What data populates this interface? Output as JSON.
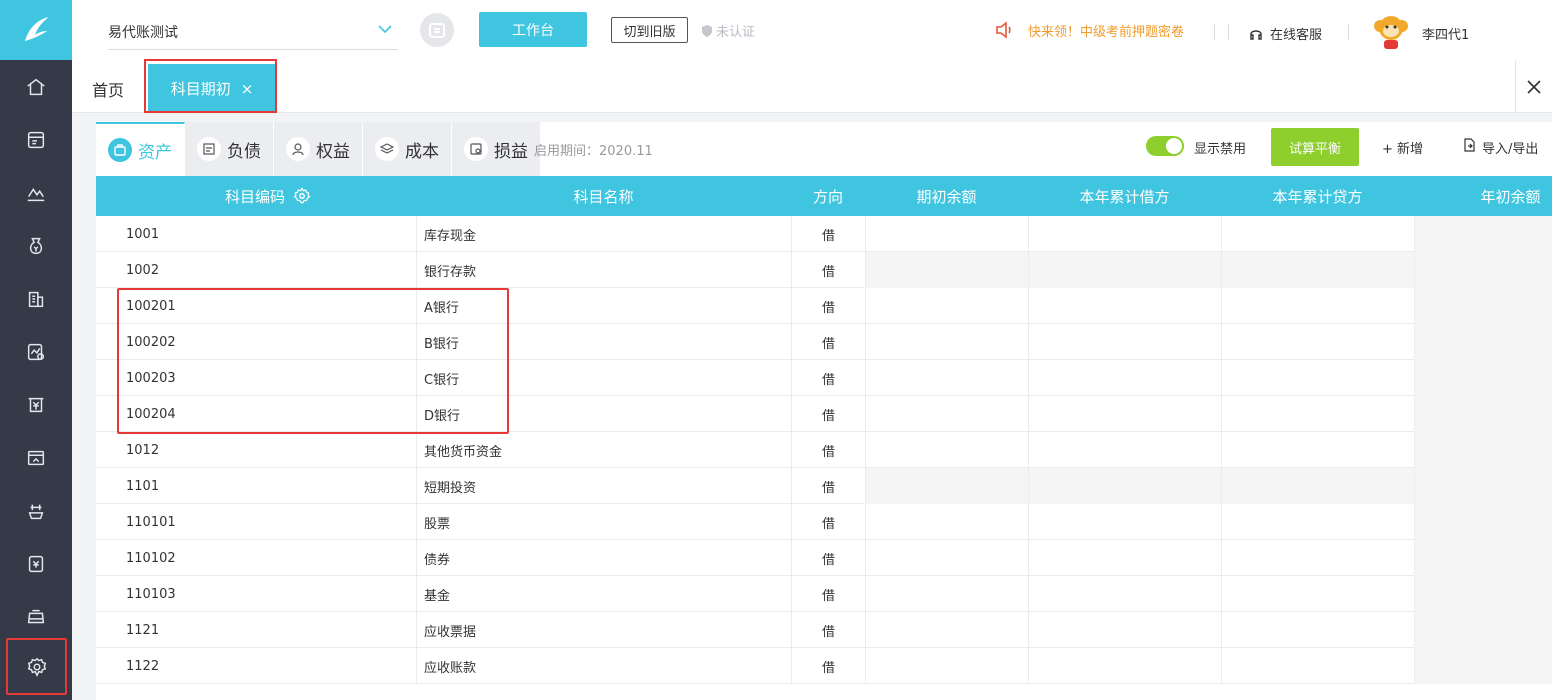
{
  "header": {
    "company": "易代账测试",
    "workbench_label": "工作台",
    "switch_old_label": "切到旧版",
    "uncertified_label": "未认证",
    "promo_text": "快来领！中级考前押题密卷",
    "service_label": "在线客服",
    "username": "李四代1"
  },
  "tabs": {
    "home_label": "首页",
    "active_label": "科目期初",
    "close_symbol": "×"
  },
  "sidebar": {
    "icons": [
      "home-icon",
      "invoice-icon",
      "chart-icon",
      "money-bag-icon",
      "building-icon",
      "report-icon",
      "yen-receipt-icon",
      "screen-icon",
      "tax-icon",
      "document-icon",
      "tray-icon",
      "settings-icon"
    ]
  },
  "categories": [
    {
      "label": "资产",
      "icon": "asset-icon",
      "active": true
    },
    {
      "label": "负债",
      "icon": "liability-icon",
      "active": false
    },
    {
      "label": "权益",
      "icon": "equity-icon",
      "active": false
    },
    {
      "label": "成本",
      "icon": "cost-icon",
      "active": false
    },
    {
      "label": "损益",
      "icon": "pnl-icon",
      "active": false
    }
  ],
  "toolbar": {
    "period": "启用期间：2020.11",
    "show_disabled_label": "显示禁用",
    "show_disabled_on": true,
    "trial_balance_label": "试算平衡",
    "add_label": "+ 新增",
    "import_export_label": "导入/导出"
  },
  "table": {
    "columns": [
      "科目编码",
      "科目名称",
      "方向",
      "期初余额",
      "本年累计借方",
      "本年累计贷方",
      "年初余额"
    ],
    "rows": [
      {
        "code": "1001",
        "name": "库存现金",
        "dir": "借"
      },
      {
        "code": "1002",
        "name": "银行存款",
        "dir": "借"
      },
      {
        "code": "100201",
        "name": "A银行",
        "dir": "借"
      },
      {
        "code": "100202",
        "name": "B银行",
        "dir": "借"
      },
      {
        "code": "100203",
        "name": "C银行",
        "dir": "借"
      },
      {
        "code": "100204",
        "name": "D银行",
        "dir": "借"
      },
      {
        "code": "1012",
        "name": "其他货币资金",
        "dir": "借"
      },
      {
        "code": "1101",
        "name": "短期投资",
        "dir": "借"
      },
      {
        "code": "110101",
        "name": "股票",
        "dir": "借"
      },
      {
        "code": "110102",
        "name": "债券",
        "dir": "借"
      },
      {
        "code": "110103",
        "name": "基金",
        "dir": "借"
      },
      {
        "code": "1121",
        "name": "应收票据",
        "dir": "借"
      },
      {
        "code": "1122",
        "name": "应收账款",
        "dir": "借"
      }
    ]
  },
  "colors": {
    "primary": "#3fc5df",
    "green": "#8ecf2e",
    "sidebar": "#353a48",
    "highlight": "#e53935",
    "promo": "#f19b2c"
  }
}
